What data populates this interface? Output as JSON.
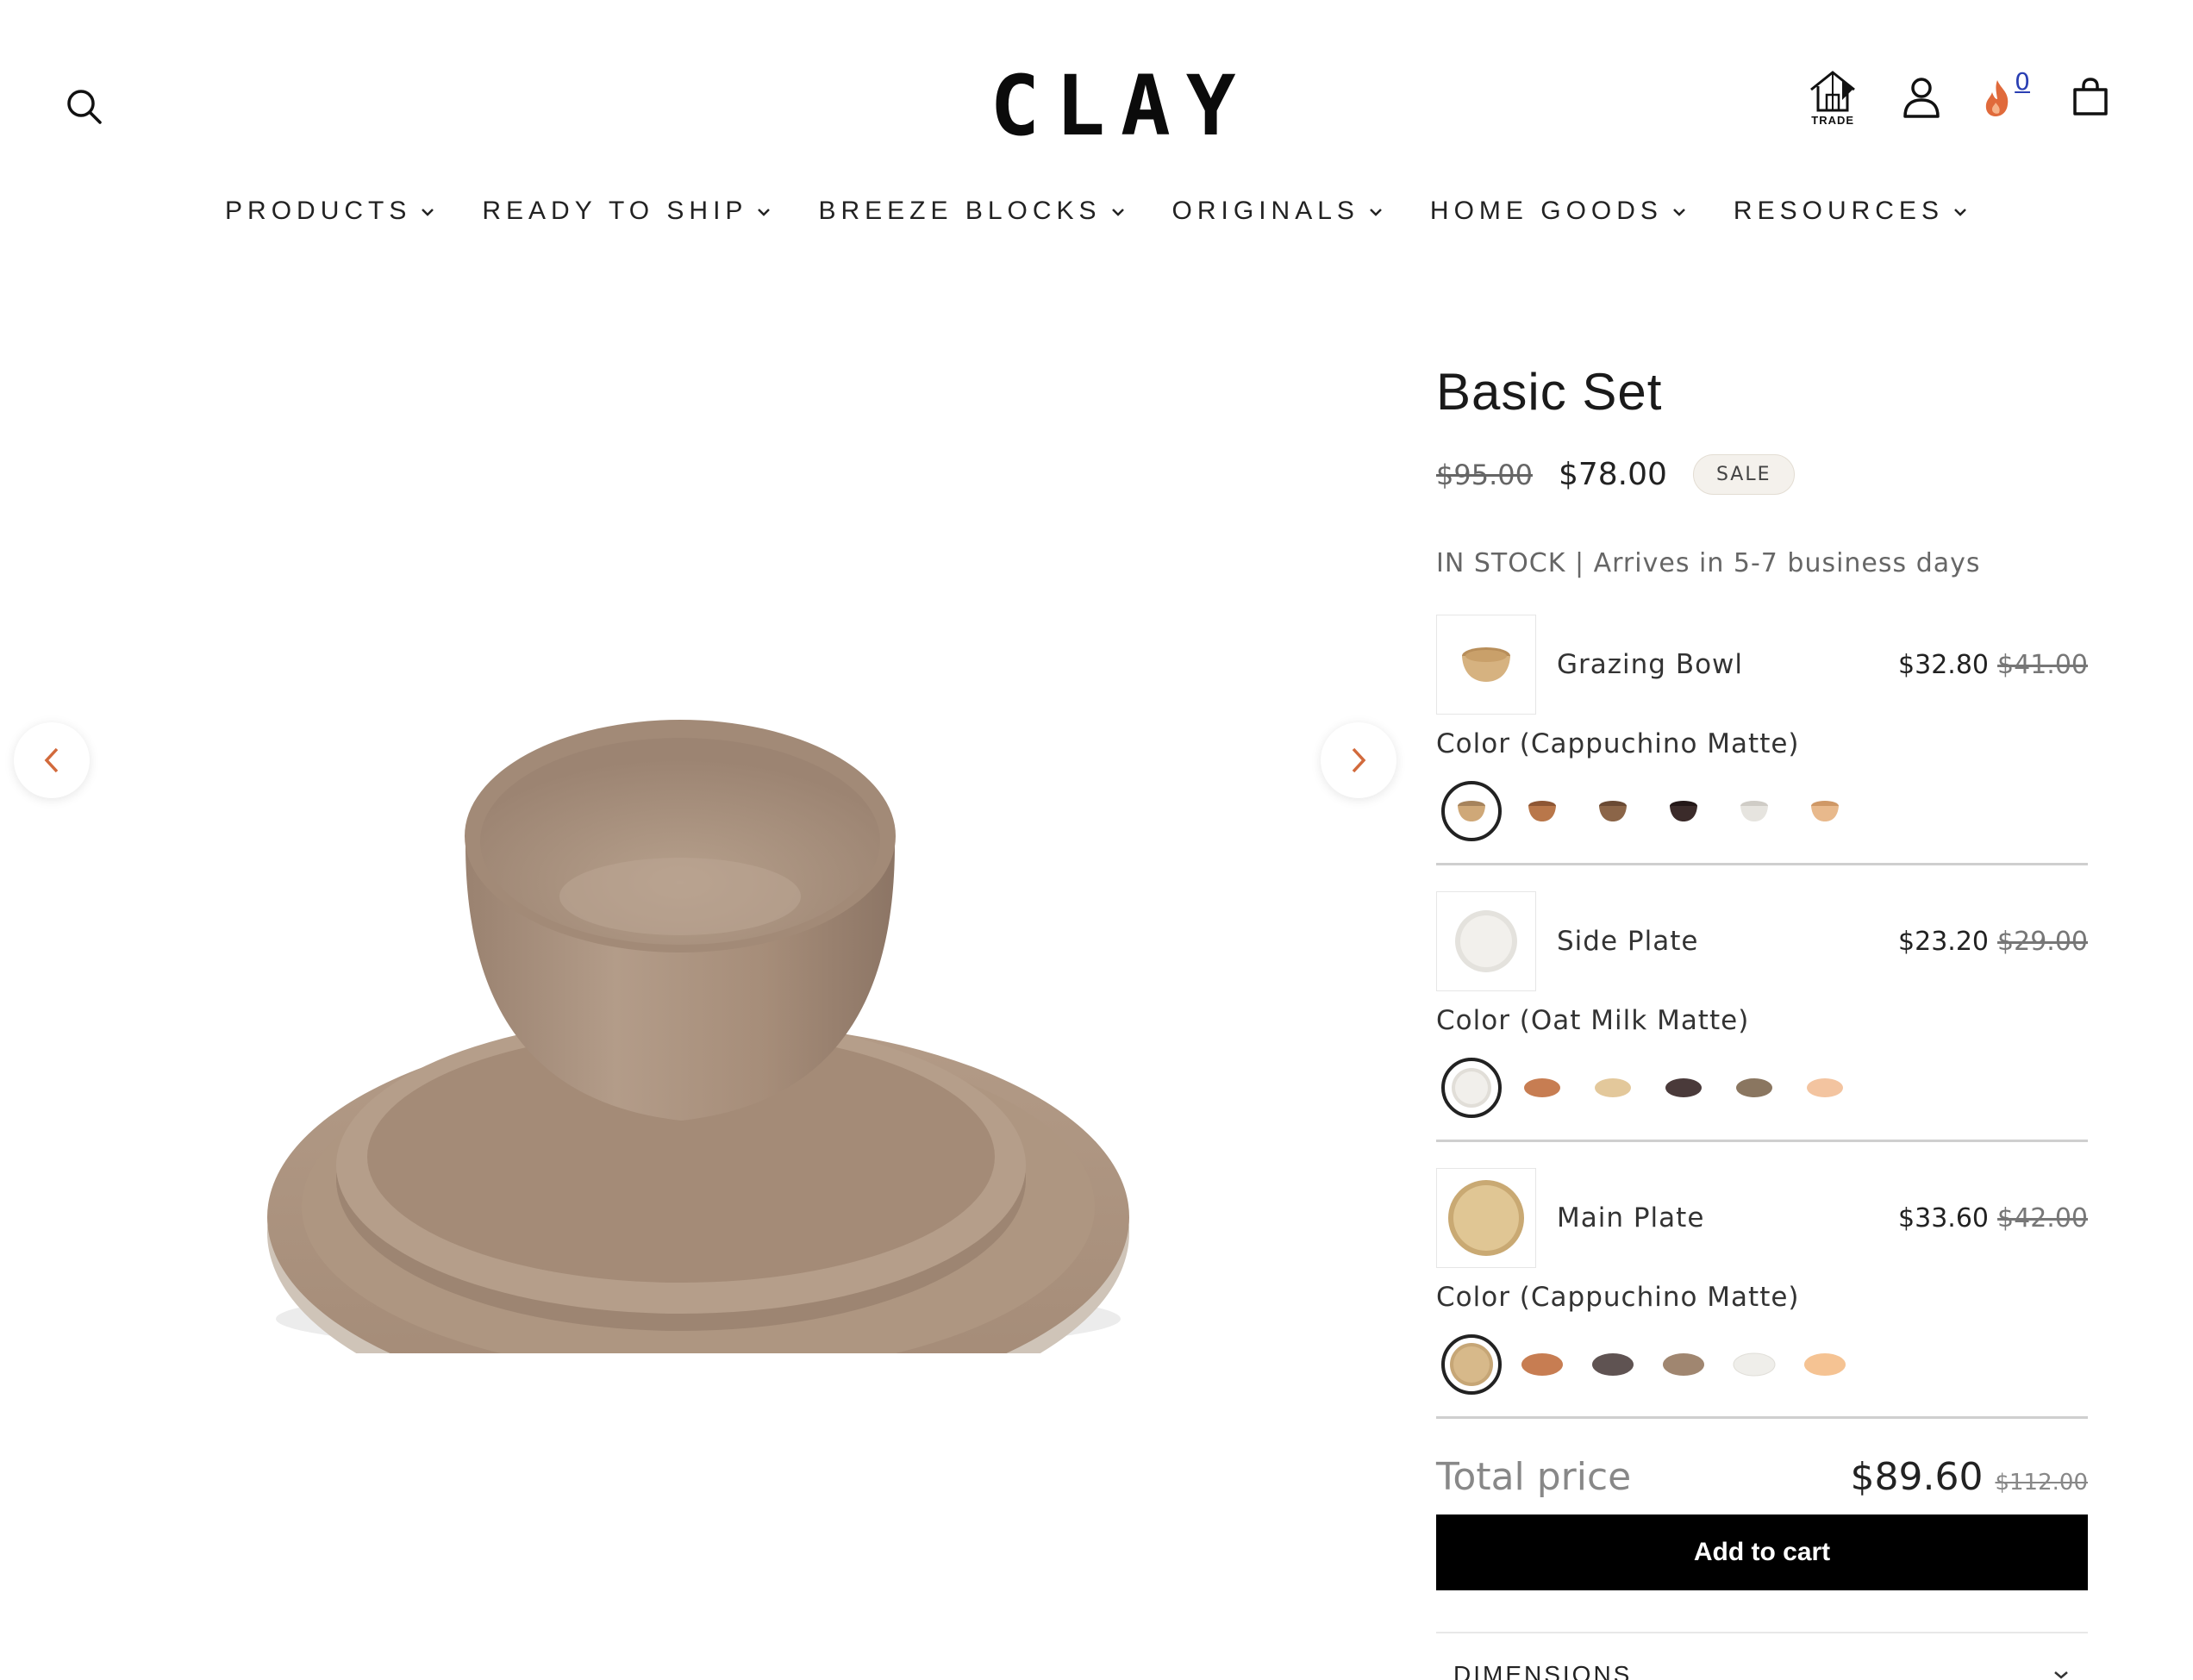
{
  "header": {
    "logo": "CLAY",
    "trade_label": "TRADE",
    "rewards_count": "0"
  },
  "nav": [
    {
      "label": "PRODUCTS"
    },
    {
      "label": "READY TO SHIP"
    },
    {
      "label": "BREEZE BLOCKS"
    },
    {
      "label": "ORIGINALS"
    },
    {
      "label": "HOME GOODS"
    },
    {
      "label": "RESOURCES"
    }
  ],
  "product": {
    "title": "Basic Set",
    "price_old": "$95.00",
    "price_new": "$78.00",
    "badge": "SALE",
    "stock": "IN STOCK | Arrives in 5-7 business days"
  },
  "items": [
    {
      "name": "Grazing Bowl",
      "price": "$32.80",
      "price_old": "$41.00",
      "color_label": "Color (Cappuchino Matte)",
      "swatch_colors": [
        "#cfa878",
        "#b9774a",
        "#8b6548",
        "#3b2b2a",
        "#e6e4df",
        "#e8b98c"
      ]
    },
    {
      "name": "Side Plate",
      "price": "$23.20",
      "price_old": "$29.00",
      "color_label": "Color (Oat Milk Matte)",
      "swatch_colors": [
        "#eeece7",
        "#c77d52",
        "#e3c89b",
        "#4a3a3a",
        "#8a7660",
        "#f3c4a0"
      ]
    },
    {
      "name": "Main Plate",
      "price": "$33.60",
      "price_old": "$42.00",
      "color_label": "Color (Cappuchino Matte)",
      "swatch_colors": [
        "#d7b98a",
        "#c77d52",
        "#5f5352",
        "#a08670",
        "#efeeea",
        "#f5c393"
      ]
    }
  ],
  "total": {
    "label": "Total price",
    "price": "$89.60",
    "price_old": "$112.00"
  },
  "cta": {
    "add_to_cart": "Add to cart"
  },
  "accordion": {
    "dimensions": "DIMENSIONS"
  },
  "colors": {
    "accent": "#000000",
    "fire": "#e06a3b"
  }
}
